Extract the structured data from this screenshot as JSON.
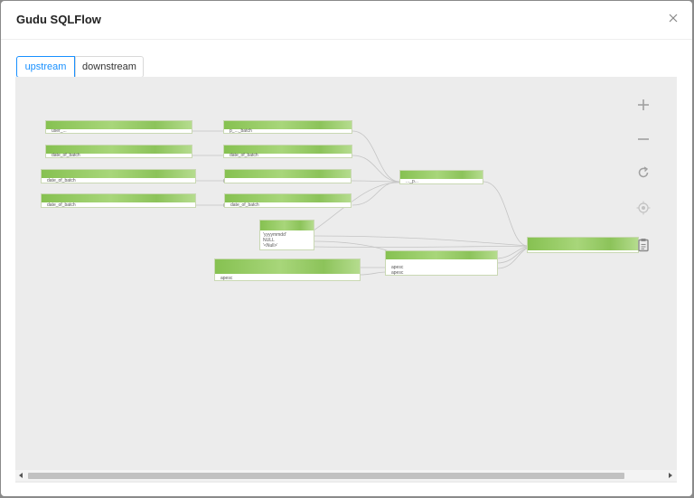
{
  "modal": {
    "title": "Gudu SQLFlow"
  },
  "tabs": [
    {
      "label": "upstream",
      "active": true
    },
    {
      "label": "downstream",
      "active": false
    }
  ],
  "graph": {
    "nodes": [
      {
        "id": "n1",
        "rows": [
          "user_..."
        ]
      },
      {
        "id": "n2",
        "rows": [
          "date_of_batch"
        ]
      },
      {
        "id": "n3",
        "rows": [
          "date_of_batch"
        ]
      },
      {
        "id": "n4",
        "rows": [
          "date_of_batch"
        ]
      },
      {
        "id": "n5",
        "rows": [
          "p_..._batch"
        ]
      },
      {
        "id": "n6",
        "rows": [
          "date_of_batch"
        ]
      },
      {
        "id": "n7",
        "rows": [
          ""
        ]
      },
      {
        "id": "n8",
        "rows": [
          "date_of_batch"
        ]
      },
      {
        "id": "n9",
        "rows": [
          "..._p..."
        ]
      },
      {
        "id": "n10",
        "rows": [
          "'yyyymmdd'",
          "NULL",
          "'<Null>'"
        ]
      },
      {
        "id": "n11",
        "rows": [
          "apesc"
        ]
      },
      {
        "id": "n12",
        "rows": [
          "apesc",
          "apesc"
        ]
      },
      {
        "id": "n13",
        "rows": [
          ""
        ]
      }
    ]
  },
  "controls": {
    "icons": [
      "zoom-in-icon",
      "zoom-out-icon",
      "refresh-icon",
      "locate-icon",
      "clipboard-icon"
    ]
  },
  "colors": {
    "accent": "#1890ff",
    "node_header": "#8fc35c",
    "canvas": "#ececec"
  }
}
